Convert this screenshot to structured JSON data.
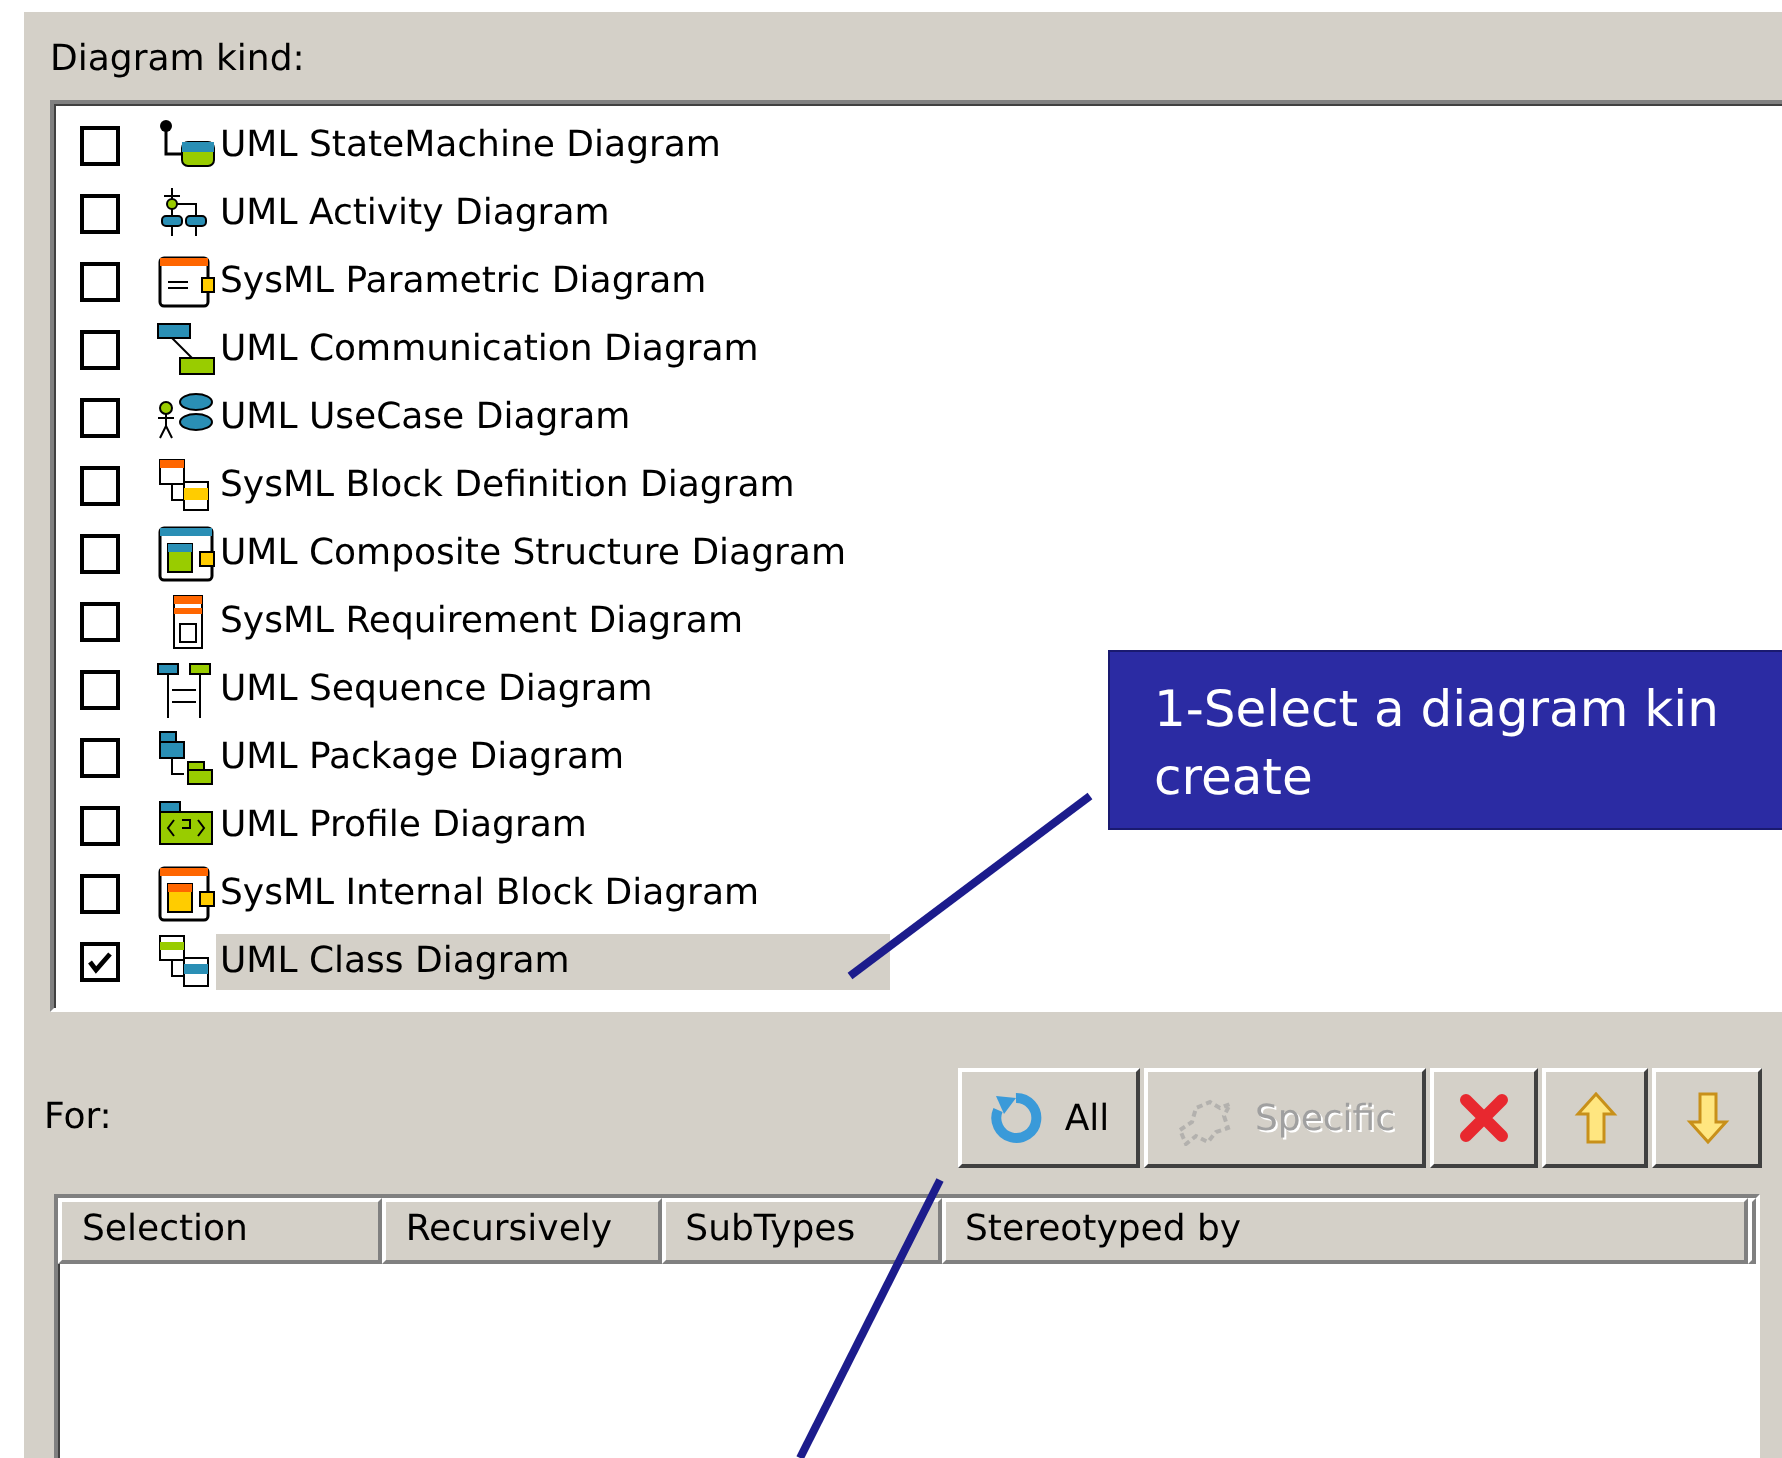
{
  "diagram_kind": {
    "label": "Diagram kind:",
    "items": [
      {
        "label": "UML StateMachine Diagram",
        "checked": false,
        "selected": false
      },
      {
        "label": "UML Activity Diagram",
        "checked": false,
        "selected": false
      },
      {
        "label": "SysML Parametric Diagram",
        "checked": false,
        "selected": false
      },
      {
        "label": "UML Communication Diagram",
        "checked": false,
        "selected": false
      },
      {
        "label": "UML UseCase Diagram",
        "checked": false,
        "selected": false
      },
      {
        "label": "SysML Block Definition Diagram",
        "checked": false,
        "selected": false
      },
      {
        "label": "UML Composite Structure Diagram",
        "checked": false,
        "selected": false
      },
      {
        "label": "SysML Requirement Diagram",
        "checked": false,
        "selected": false
      },
      {
        "label": "UML Sequence Diagram",
        "checked": false,
        "selected": false
      },
      {
        "label": "UML Package Diagram",
        "checked": false,
        "selected": false
      },
      {
        "label": "UML Profile Diagram",
        "checked": false,
        "selected": false
      },
      {
        "label": "SysML Internal Block Diagram",
        "checked": false,
        "selected": false
      },
      {
        "label": "UML Class Diagram",
        "checked": true,
        "selected": true
      }
    ]
  },
  "for": {
    "label": "For:",
    "buttons": [
      {
        "kind": "all",
        "label": "All",
        "disabled": false
      },
      {
        "kind": "specific",
        "label": "Specific",
        "disabled": true
      },
      {
        "kind": "delete",
        "disabled": false
      },
      {
        "kind": "up",
        "disabled": false
      },
      {
        "kind": "down",
        "disabled": false
      }
    ],
    "table": {
      "columns": [
        "Selection",
        "Recursively",
        "SubTypes",
        "Stereotyped by"
      ]
    }
  },
  "callout": {
    "lines": [
      "1-Select a diagram kin",
      "create"
    ]
  }
}
